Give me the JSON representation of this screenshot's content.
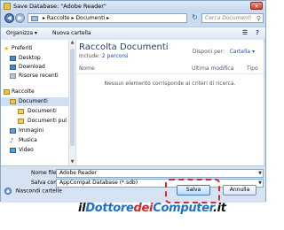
{
  "window": {
    "title": "Save Database: \"Adobe Reader\"",
    "close_glyph": "×"
  },
  "nav": {
    "back_glyph": "◀",
    "forward_glyph": "▶",
    "address": "▸ Raccolte ▸ Documenti ▸",
    "refresh_glyph": "↻",
    "search_placeholder": "Cerca Documenti",
    "search_glyph": "⚲"
  },
  "toolbar": {
    "organize": "Organizza ▾",
    "new_folder": "Nuova cartella",
    "view_glyph": "☰",
    "help_glyph": "?"
  },
  "sidebar": {
    "items": [
      {
        "label": "Preferiti",
        "icon": "star-icon",
        "color": "#e8b320"
      },
      {
        "label": "Desktop",
        "icon": "desktop-icon",
        "color": "#4a86c8"
      },
      {
        "label": "Download",
        "icon": "download-icon",
        "color": "#4a86c8"
      },
      {
        "label": "Risorse recenti",
        "icon": "recent-icon",
        "color": "#7a8ea8"
      },
      {
        "label": "Raccolte",
        "icon": "libraries-icon",
        "color": "#d9a93a"
      },
      {
        "label": "Documenti",
        "icon": "documents-icon",
        "color": "#d9a93a"
      },
      {
        "label": "Documenti",
        "icon": "folder-icon",
        "color": "#e8c34a"
      },
      {
        "label": "Documenti pul",
        "icon": "folder-icon",
        "color": "#e8c34a"
      },
      {
        "label": "Immagini",
        "icon": "pictures-icon",
        "color": "#5aa0d8"
      },
      {
        "label": "Musica",
        "icon": "music-icon",
        "color": "#5aa0d8"
      },
      {
        "label": "Video",
        "icon": "video-icon",
        "color": "#5aa0d8"
      }
    ],
    "scroll_up": "▲",
    "scroll_down": "▼"
  },
  "main": {
    "library_title": "Raccolta Documenti",
    "includes_label": "Include:",
    "includes_link": "2 percorsi",
    "sort_label": "Disponi per:",
    "sort_value": "Cartella ▾",
    "columns": [
      "Nome",
      "Ultima modifica",
      "Tipo"
    ],
    "empty_message": "Nessun elemento corrisponde ai criteri di ricerca."
  },
  "form": {
    "filename_label": "Nome file:",
    "filename_value": "Adobe Reader",
    "savetype_label": "Salva come:",
    "savetype_value": "AppCompat Database (*.sdb)",
    "dropdown_glyph": "▼"
  },
  "footer": {
    "hide_folders_chevron": "▲",
    "hide_folders": "Nascondi cartelle",
    "save_button": "Salva",
    "cancel_button": "Annulla"
  },
  "watermark": {
    "parts": [
      {
        "text": "il",
        "color": "#111111"
      },
      {
        "text": "Dottore",
        "color": "#1f6fc9"
      },
      {
        "text": "dei",
        "color": "#d1292c"
      },
      {
        "text": "Computer",
        "color": "#1f6fc9"
      },
      {
        "text": ".it",
        "color": "#111111"
      }
    ]
  }
}
